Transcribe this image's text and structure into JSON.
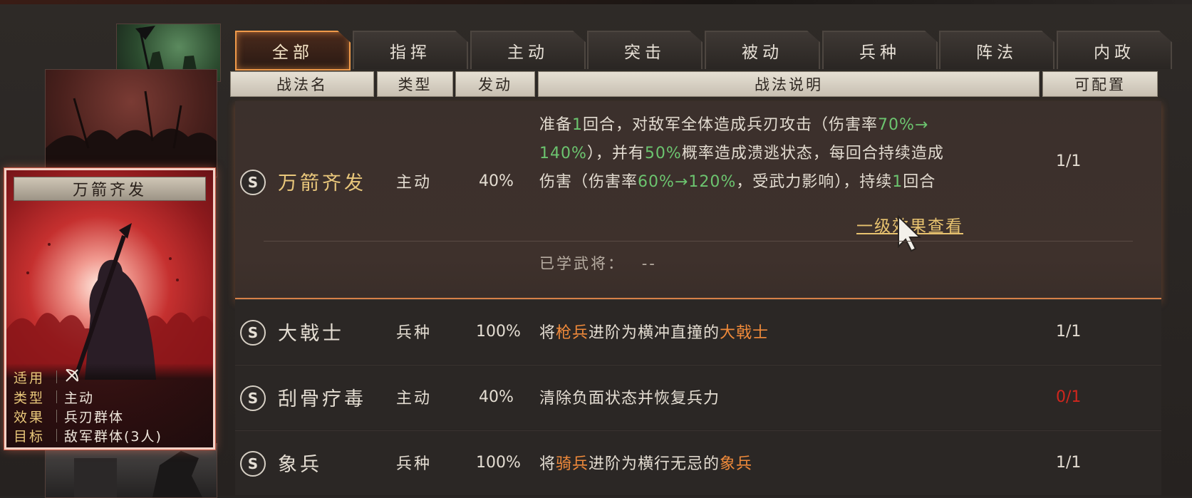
{
  "tabs": [
    "全部",
    "指挥",
    "主动",
    "突击",
    "被动",
    "兵种",
    "阵法",
    "内政"
  ],
  "active_tab": "全部",
  "columns": {
    "name": "战法名",
    "type": "类型",
    "trigger": "发动",
    "desc": "战法说明",
    "config": "可配置"
  },
  "card": {
    "title": "万箭齐发",
    "rows": [
      {
        "k": "适用",
        "v": ""
      },
      {
        "k": "类型",
        "v": "主动"
      },
      {
        "k": "效果",
        "v": "兵刃群体"
      },
      {
        "k": "目标",
        "v": "敌军群体(3人)"
      }
    ]
  },
  "tactics": [
    {
      "grade": "S",
      "name": "万箭齐发",
      "type": "主动",
      "trigger": "40%",
      "config": "1/1",
      "desc": {
        "line1_a": "准备",
        "line1_b": "1",
        "line1_c": "回合，对敌军全体造成兵刃攻击（伤害率",
        "line1_d": "70%→",
        "line2_a": "140%",
        "line2_b": "），并有",
        "line2_c": "50%",
        "line2_d": "概率造成溃逃状态，每回合持续造成",
        "line3_a": "伤害（伤害率",
        "line3_b": "60%→120%",
        "line3_c": "，受武力影响），持续",
        "line3_d": "1",
        "line3_e": "回合"
      },
      "more_link": "一级效果查看",
      "learned_label": "已学武将：",
      "learned_value": "--"
    },
    {
      "grade": "S",
      "name": "大戟士",
      "type": "兵种",
      "trigger": "100%",
      "config": "1/1",
      "desc": {
        "a": "将",
        "b": "枪兵",
        "c": "进阶为横冲直撞的",
        "d": "大戟士"
      }
    },
    {
      "grade": "S",
      "name": "刮骨疗毒",
      "type": "主动",
      "trigger": "40%",
      "config": "0/1",
      "desc": {
        "a": "清除负面状态并恢复兵力"
      }
    },
    {
      "grade": "S",
      "name": "象兵",
      "type": "兵种",
      "trigger": "100%",
      "config": "1/1",
      "desc": {
        "a": "将",
        "b": "骑兵",
        "c": "进阶为横行无忌的",
        "d": "象兵"
      }
    }
  ],
  "colors": {
    "accent_orange": "#f08a3a",
    "green": "#6cc46f",
    "gold": "#e9c77b",
    "red_count": "#d0261d"
  }
}
